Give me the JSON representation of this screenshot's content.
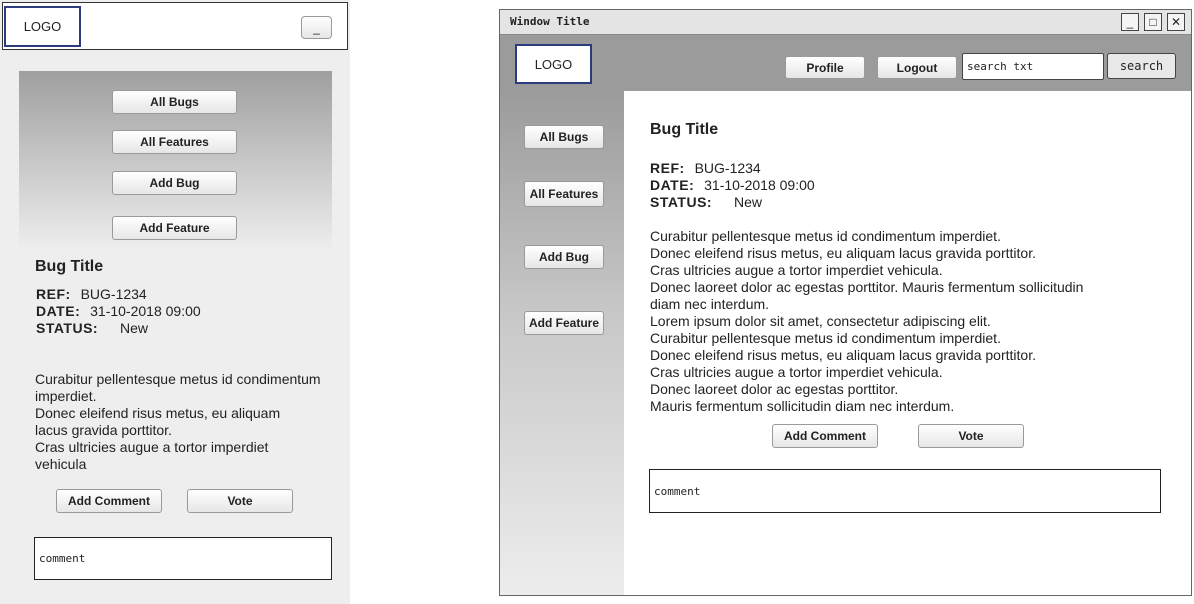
{
  "mobile": {
    "logo": "LOGO",
    "menu_toggle": "_",
    "nav": [
      "All Bugs",
      "All Features",
      "Add Bug",
      "Add Feature"
    ],
    "bug": {
      "title": "Bug Title",
      "ref_label": "REF:",
      "ref_value": "BUG-1234",
      "date_label": "DATE:",
      "date_value": "31-10-2018 09:00",
      "status_label": "STATUS:",
      "status_value": "New",
      "description": [
        "Curabitur pellentesque metus id condimentum",
        "imperdiet.",
        "Donec eleifend risus metus, eu aliquam",
        "lacus gravida porttitor.",
        "Cras ultricies augue a tortor imperdiet",
        "vehicula"
      ]
    },
    "actions": {
      "add_comment": "Add Comment",
      "vote": "Vote"
    },
    "comment_placeholder": "comment"
  },
  "desktop": {
    "window_title": "Window Title",
    "window_controls": {
      "minimize": "_",
      "maximize": "□",
      "close": "✕"
    },
    "logo": "LOGO",
    "header": {
      "profile": "Profile",
      "logout": "Logout",
      "search_text": "search txt",
      "search_button": "search"
    },
    "nav": [
      "All Bugs",
      "All Features",
      "Add Bug",
      "Add Feature"
    ],
    "bug": {
      "title": "Bug Title",
      "ref_label": "REF:",
      "ref_value": "BUG-1234",
      "date_label": "DATE:",
      "date_value": "31-10-2018 09:00",
      "status_label": "STATUS:",
      "status_value": "New",
      "description": [
        "Curabitur pellentesque metus id condimentum imperdiet.",
        "Donec eleifend risus metus, eu aliquam lacus gravida porttitor.",
        "Cras ultricies augue a tortor imperdiet vehicula.",
        "Donec laoreet dolor ac egestas porttitor. Mauris fermentum sollicitudin",
        "diam nec interdum.",
        "Lorem ipsum dolor sit amet, consectetur adipiscing elit.",
        "Curabitur pellentesque metus id condimentum imperdiet.",
        "Donec eleifend risus metus, eu aliquam lacus gravida porttitor.",
        "Cras ultricies augue a tortor imperdiet vehicula.",
        "Donec laoreet dolor ac egestas porttitor.",
        "Mauris fermentum sollicitudin diam nec interdum."
      ]
    },
    "actions": {
      "add_comment": "Add Comment",
      "vote": "Vote"
    },
    "comment_placeholder": "comment"
  }
}
